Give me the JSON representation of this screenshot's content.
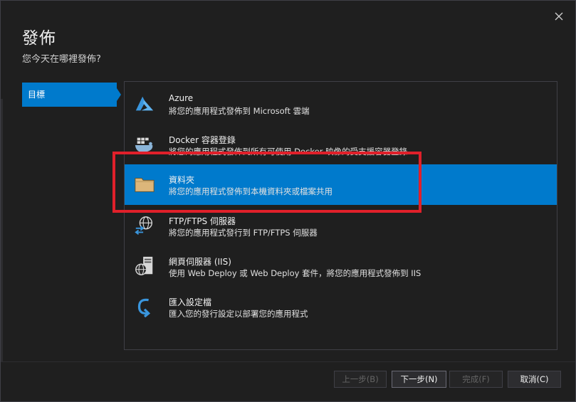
{
  "dialog": {
    "title": "發佈",
    "subtitle": "您今天在哪裡發佈?"
  },
  "nav": {
    "items": [
      {
        "label": "目標",
        "selected": true
      }
    ]
  },
  "targets": [
    {
      "title": "Azure",
      "description": "將您的應用程式發佈到 Microsoft 雲端",
      "icon": "azure-icon"
    },
    {
      "title": "Docker 容器登錄",
      "description": "將您的應用程式發佈到所有可使用 Docker 映像的受支援容器登錄",
      "icon": "docker-icon"
    },
    {
      "title": "資料夾",
      "description": "將您的應用程式發佈到本機資料夾或檔案共用",
      "icon": "folder-icon",
      "selected": true
    },
    {
      "title": "FTP/FTPS 伺服器",
      "description": "將您的應用程式發行到 FTP/FTPS 伺服器",
      "icon": "ftp-globe-icon"
    },
    {
      "title": "網頁伺服器 (IIS)",
      "description": "使用 Web Deploy 或 Web Deploy 套件，將您的應用程式發佈到 IIS",
      "icon": "web-server-icon"
    },
    {
      "title": "匯入設定檔",
      "description": "匯入您的發行設定以部署您的應用程式",
      "icon": "import-arrow-icon"
    }
  ],
  "buttons": {
    "back": "上一步(B)",
    "next": "下一步(N)",
    "finish": "完成(F)",
    "cancel": "取消(C)"
  },
  "colors": {
    "accent": "#007acc",
    "highlight": "#e0202a",
    "background": "#1f1f1f"
  }
}
